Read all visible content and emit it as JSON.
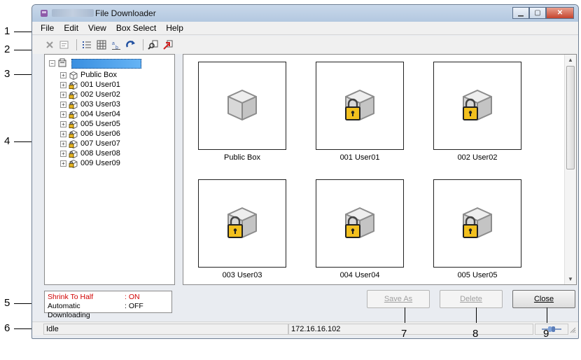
{
  "window": {
    "title": "File Downloader"
  },
  "menu": [
    "File",
    "Edit",
    "View",
    "Box Select",
    "Help"
  ],
  "toolbar_icons": [
    "delete-icon",
    "properties-icon",
    "list-view-icon",
    "thumbnail-view-icon",
    "rename-icon",
    "refresh-icon",
    "search-icon",
    "download-icon"
  ],
  "tree": {
    "items": [
      {
        "label": "Public Box",
        "icon": "box-icon"
      },
      {
        "label": "001 User01",
        "icon": "locked-box-icon"
      },
      {
        "label": "002 User02",
        "icon": "locked-box-icon"
      },
      {
        "label": "003 User03",
        "icon": "locked-box-icon"
      },
      {
        "label": "004 User04",
        "icon": "locked-box-icon"
      },
      {
        "label": "005 User05",
        "icon": "locked-box-icon"
      },
      {
        "label": "006 User06",
        "icon": "locked-box-icon"
      },
      {
        "label": "007 User07",
        "icon": "locked-box-icon"
      },
      {
        "label": "008 User08",
        "icon": "locked-box-icon"
      },
      {
        "label": "009 User09",
        "icon": "locked-box-icon"
      }
    ]
  },
  "tiles": [
    {
      "label": "Public Box",
      "locked": false
    },
    {
      "label": "001 User01",
      "locked": true
    },
    {
      "label": "002 User02",
      "locked": true
    },
    {
      "label": "003 User03",
      "locked": true
    },
    {
      "label": "004 User04",
      "locked": true
    },
    {
      "label": "005 User05",
      "locked": true
    }
  ],
  "status": {
    "shrink_label": "Shrink To Half",
    "shrink_value": ": ON",
    "auto_label": "Automatic Downloading",
    "auto_value": ": OFF"
  },
  "buttons": {
    "save_as": "Save As",
    "delete": "Delete",
    "close": "Close"
  },
  "statusbar": {
    "state": "Idle",
    "ip": "172.16.16.102"
  },
  "callouts": [
    "1",
    "2",
    "3",
    "4",
    "5",
    "6",
    "7",
    "8",
    "9"
  ],
  "colors": {
    "selection": "#3a8fe0",
    "shrink_on": "#d00000"
  }
}
